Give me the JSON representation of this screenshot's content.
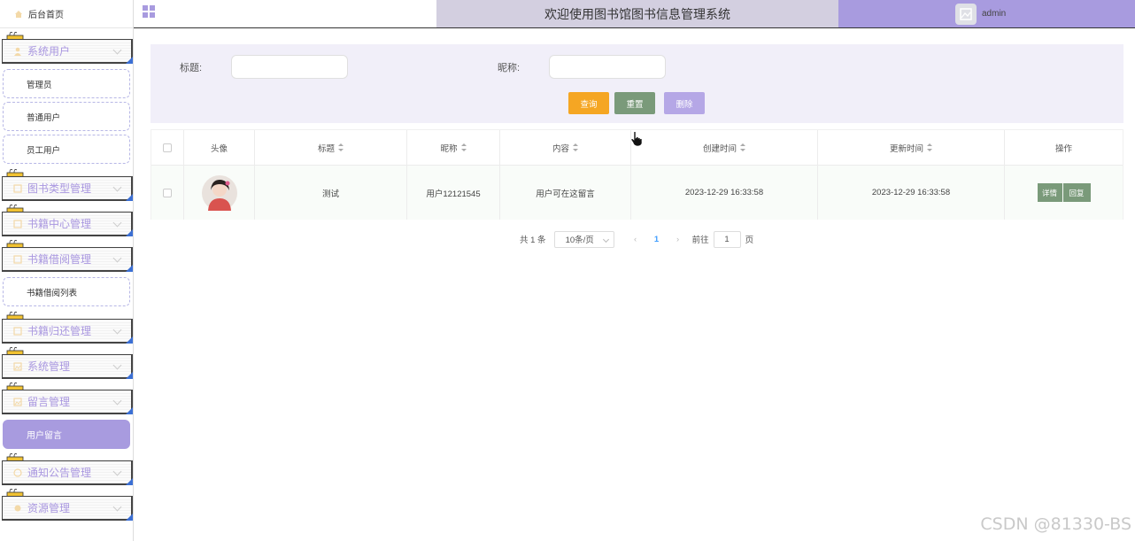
{
  "sidebar": {
    "home": "后台首页",
    "sections": [
      {
        "label": "系统用户",
        "items": [
          "管理员",
          "普通用户",
          "员工用户"
        ]
      },
      {
        "label": "图书类型管理",
        "items": []
      },
      {
        "label": "书籍中心管理",
        "items": []
      },
      {
        "label": "书籍借阅管理",
        "items": [
          "书籍借阅列表"
        ]
      },
      {
        "label": "书籍归还管理",
        "items": []
      },
      {
        "label": "系统管理",
        "items": []
      },
      {
        "label": "留言管理",
        "items": [
          "用户留言"
        ]
      },
      {
        "label": "通知公告管理",
        "items": []
      },
      {
        "label": "资源管理",
        "items": []
      }
    ],
    "active_item": "用户留言"
  },
  "header": {
    "title": "欢迎使用图书馆图书信息管理系统",
    "username": "admin"
  },
  "search": {
    "title_label": "标题:",
    "nickname_label": "昵称:",
    "title_value": "",
    "nickname_value": "",
    "query_btn": "查询",
    "reset_btn": "重置",
    "delete_btn": "删除"
  },
  "table": {
    "headers": [
      "头像",
      "标题",
      "昵称",
      "内容",
      "创建时间",
      "更新时间",
      "操作"
    ],
    "rows": [
      {
        "title": "测试",
        "nickname": "用户12121545",
        "content": "用户可在这留言",
        "created": "2023-12-29 16:33:58",
        "updated": "2023-12-29 16:33:58",
        "detail_btn": "详情",
        "reply_btn": "回复"
      }
    ]
  },
  "pager": {
    "total": "共 1 条",
    "page_size": "10条/页",
    "current": "1",
    "goto_prefix": "前往",
    "goto_value": "1",
    "goto_suffix": "页"
  },
  "watermark": "CSDN @81330-BS",
  "colors": {
    "accent": "#a89bdf",
    "query": "#f5a623",
    "reset": "#7a9a7a",
    "delete": "#b5a7e6"
  }
}
